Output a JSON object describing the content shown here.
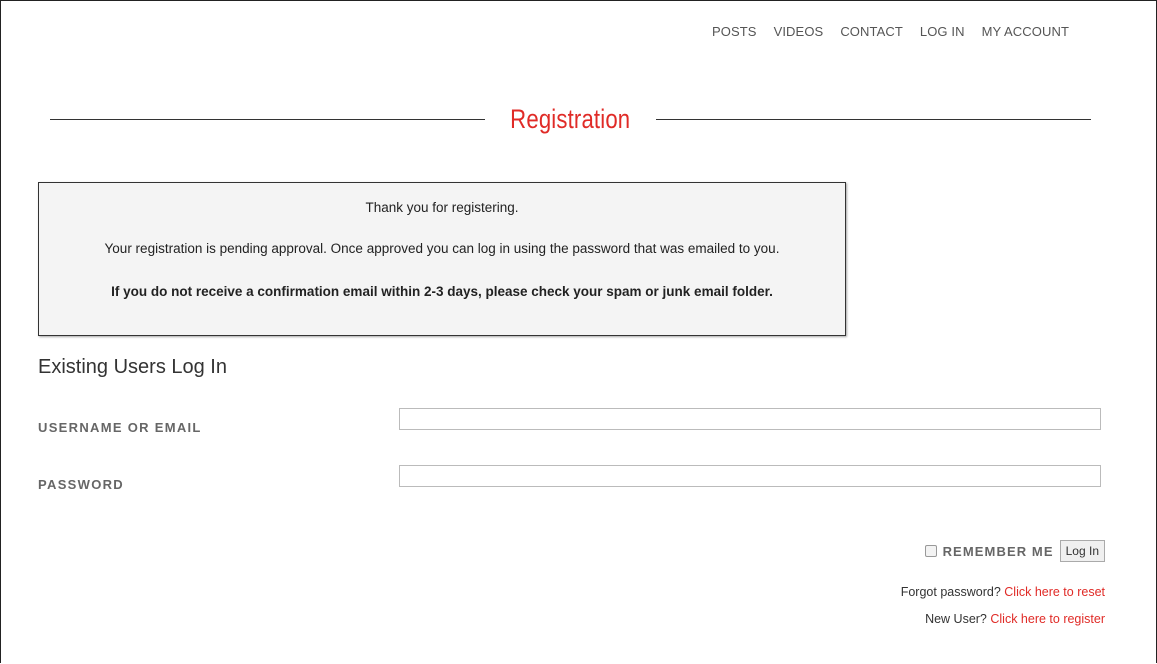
{
  "nav": {
    "items": [
      "POSTS",
      "VIDEOS",
      "CONTACT",
      "LOG IN",
      "MY ACCOUNT"
    ]
  },
  "page": {
    "title": "Registration"
  },
  "notice": {
    "line1": "Thank you for registering.",
    "line2": "Your registration is pending approval. Once approved you can log in using the password that was emailed to you.",
    "line3": "If you do not receive a confirmation email within 2-3 days, please check your spam or junk email folder."
  },
  "login": {
    "heading": "Existing Users Log In",
    "username_label": "USERNAME OR EMAIL",
    "username_value": "",
    "password_label": "PASSWORD",
    "password_value": "",
    "remember_label": "REMEMBER ME",
    "remember_checked": false,
    "submit_label": "Log In",
    "forgot_prefix": "Forgot password?",
    "forgot_link": "Click here to reset",
    "register_prefix": "New User?",
    "register_link": "Click here to register"
  },
  "colors": {
    "accent": "#e02b27",
    "text": "#333333",
    "label": "#666666",
    "notice_bg": "#f4f4f4"
  }
}
